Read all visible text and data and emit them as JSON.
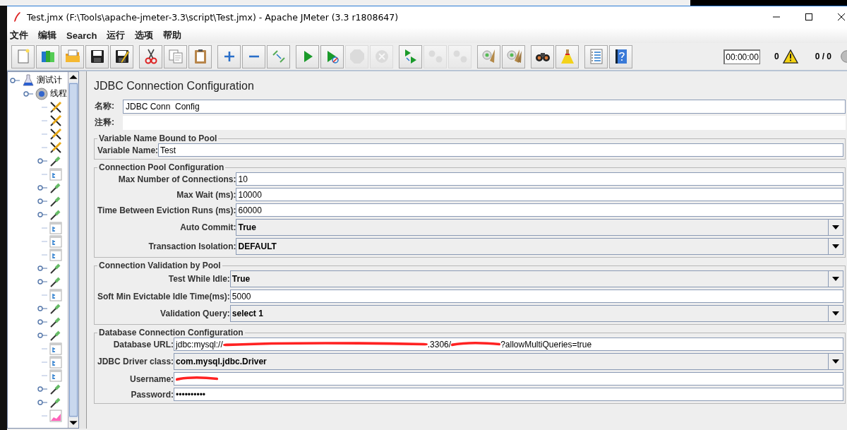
{
  "window": {
    "title": "Test.jmx (F:\\Tools\\apache-jmeter-3.3\\script\\Test.jmx) - Apache JMeter (3.3 r1808647)"
  },
  "menu": [
    "文件",
    "编辑",
    "Search",
    "运行",
    "选项",
    "帮助"
  ],
  "toolbar": [
    [
      {
        "kind": "new",
        "disabled": false
      },
      {
        "kind": "templates",
        "disabled": false
      },
      {
        "kind": "open",
        "disabled": false
      },
      {
        "kind": "save",
        "disabled": false
      },
      {
        "kind": "saveas",
        "disabled": false
      }
    ],
    [
      {
        "kind": "cut",
        "disabled": false
      },
      {
        "kind": "copy",
        "disabled": false
      },
      {
        "kind": "paste",
        "disabled": false
      }
    ],
    [
      {
        "kind": "expand",
        "disabled": false
      },
      {
        "kind": "collapse",
        "disabled": false
      },
      {
        "kind": "toggle",
        "disabled": false
      }
    ],
    [
      {
        "kind": "start",
        "disabled": false
      },
      {
        "kind": "startnp",
        "disabled": false
      },
      {
        "kind": "stop",
        "disabled": true
      },
      {
        "kind": "shutdown",
        "disabled": true
      }
    ],
    [
      {
        "kind": "remotestart",
        "disabled": false
      },
      {
        "kind": "remotestop",
        "disabled": true
      },
      {
        "kind": "remoteexit",
        "disabled": true
      }
    ],
    [
      {
        "kind": "clear",
        "disabled": false
      },
      {
        "kind": "clearall",
        "disabled": false
      }
    ],
    [
      {
        "kind": "search",
        "disabled": false
      },
      {
        "kind": "reset",
        "disabled": false
      }
    ],
    [
      {
        "kind": "function",
        "disabled": false
      },
      {
        "kind": "help",
        "disabled": false
      }
    ]
  ],
  "status": {
    "timer": "00:00:00",
    "warnings": "0",
    "threads": "0 / 0"
  },
  "tree": {
    "label": "测试计",
    "children": [
      {
        "label": "线程",
        "children": [
          {
            "kind": "tool"
          },
          {
            "kind": "tool"
          },
          {
            "kind": "tool"
          },
          {
            "kind": "tool"
          },
          {
            "kind": "sampler"
          },
          {
            "kind": "config"
          },
          {
            "kind": "sampler"
          },
          {
            "kind": "sampler"
          },
          {
            "kind": "sampler"
          },
          {
            "kind": "config"
          },
          {
            "kind": "config"
          },
          {
            "kind": "config"
          },
          {
            "kind": "sampler"
          },
          {
            "kind": "sampler"
          },
          {
            "kind": "config"
          },
          {
            "kind": "sampler"
          },
          {
            "kind": "sampler"
          },
          {
            "kind": "sampler"
          },
          {
            "kind": "config"
          },
          {
            "kind": "config"
          },
          {
            "kind": "config"
          },
          {
            "kind": "sampler"
          },
          {
            "kind": "sampler"
          },
          {
            "kind": "listener"
          }
        ]
      }
    ]
  },
  "panel": {
    "title": "JDBC Connection Configuration",
    "name_label": "名称:",
    "name_value": "JDBC Conn  Config",
    "comment_label": "注释:",
    "sections": [
      {
        "title": "Variable Name Bound to Pool",
        "rows": [
          {
            "kind": "text",
            "label": "Variable Name:",
            "value": "Test"
          }
        ]
      },
      {
        "title": "Connection Pool Configuration",
        "rows": [
          {
            "kind": "text",
            "label": "Max Number of Connections:",
            "value": "10"
          },
          {
            "kind": "text",
            "label": "Max Wait (ms):",
            "value": "10000"
          },
          {
            "kind": "text",
            "label": "Time Between Eviction Runs (ms):",
            "value": "60000"
          },
          {
            "kind": "combo",
            "label": "Auto Commit:",
            "value": "True"
          },
          {
            "kind": "combo",
            "label": "Transaction Isolation:",
            "value": "DEFAULT"
          }
        ]
      },
      {
        "title": "Connection Validation by Pool",
        "rows": [
          {
            "kind": "combo",
            "label": "Test While Idle:",
            "value": "True"
          },
          {
            "kind": "text",
            "label": "Soft Min Evictable Idle Time(ms):",
            "value": "5000"
          },
          {
            "kind": "combo",
            "label": "Validation Query:",
            "value": "select 1"
          }
        ]
      },
      {
        "title": "Database Connection Configuration",
        "rows": [
          {
            "kind": "redacted",
            "label": "Database URL:",
            "parts": [
              {
                "kind": "text",
                "value": "jdbc:mysql://"
              },
              {
                "kind": "redacted"
              },
              {
                "kind": "text",
                "value": ".3306/"
              },
              {
                "kind": "redacted"
              },
              {
                "kind": "text",
                "value": "?allowMultiQueries=true"
              }
            ]
          },
          {
            "kind": "combo",
            "label": "JDBC Driver class:",
            "value": "com.mysql.jdbc.Driver"
          },
          {
            "kind": "redacted",
            "label": "Username:",
            "parts": [
              {
                "kind": "redacted"
              }
            ]
          },
          {
            "kind": "text",
            "label": "Password:",
            "value": "••••••••••"
          }
        ]
      }
    ]
  }
}
